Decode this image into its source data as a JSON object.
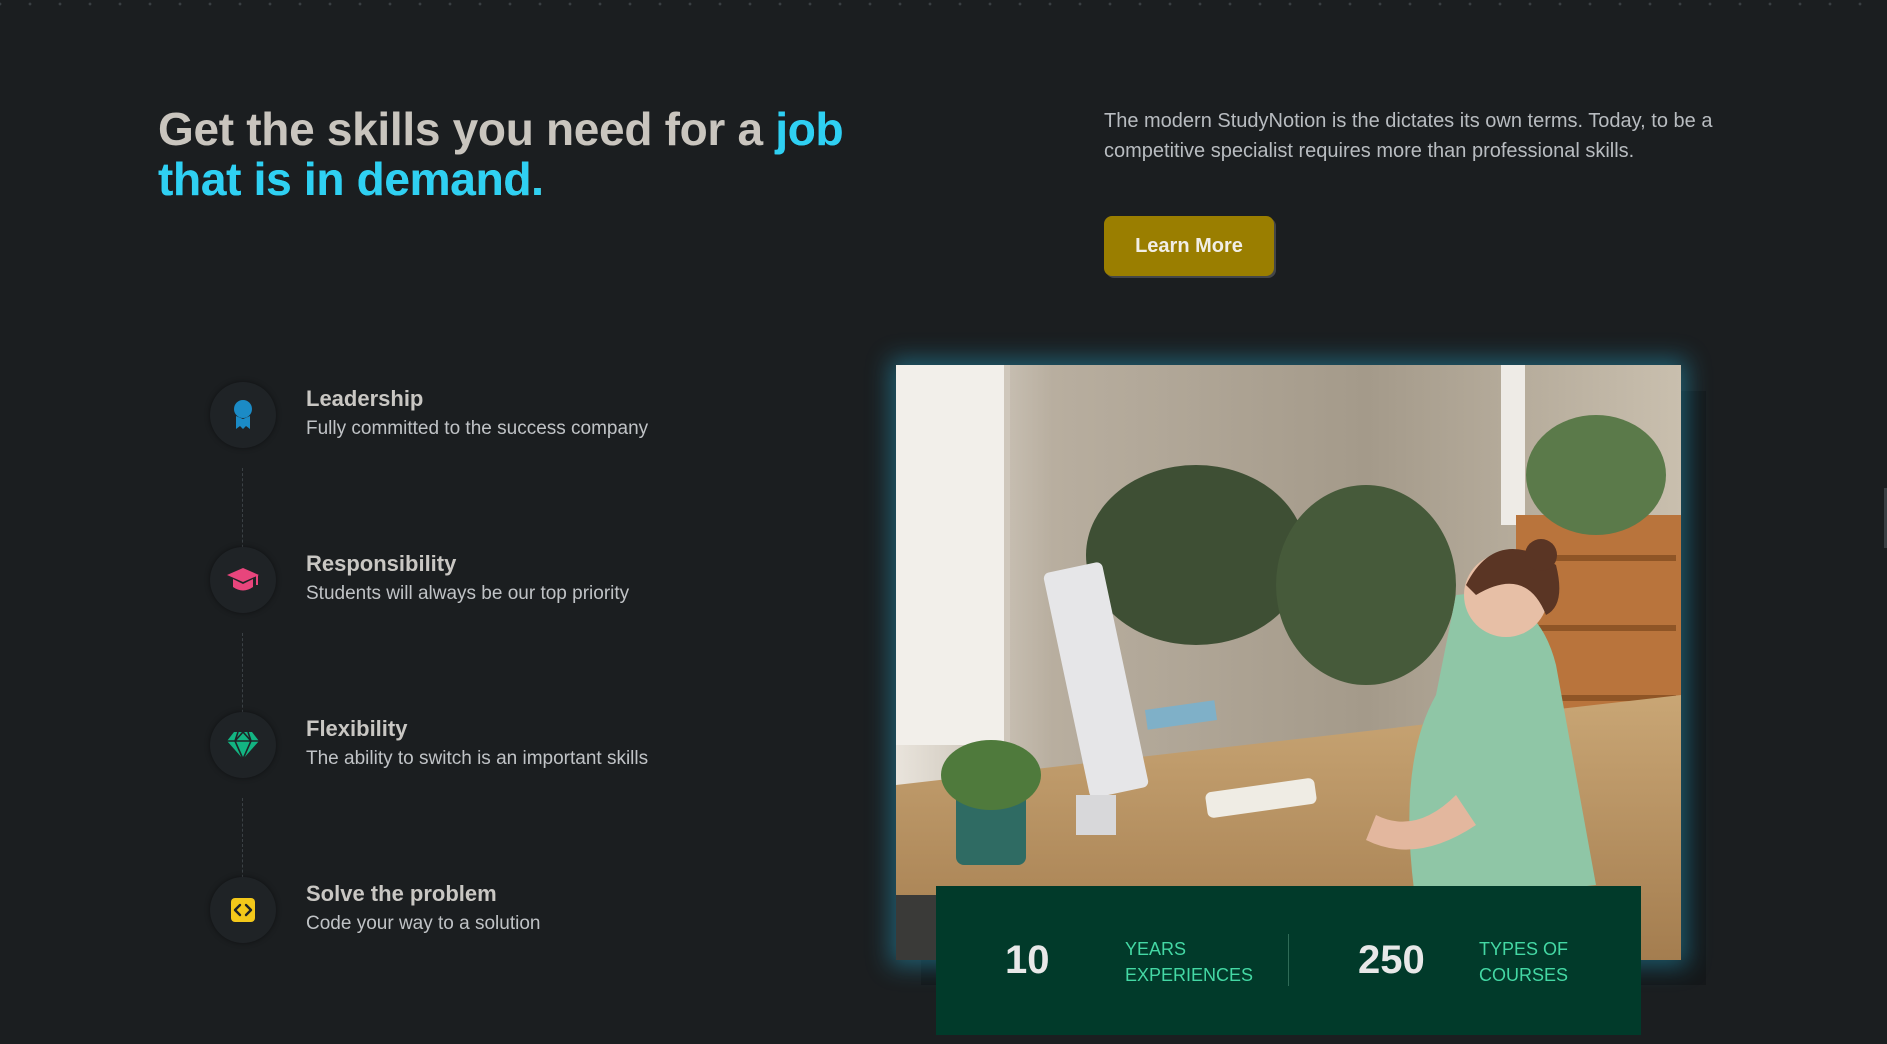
{
  "hero": {
    "headline_plain": "Get the skills you need for a ",
    "headline_accent": "job that is in demand.",
    "intro": "The modern StudyNotion is the dictates its own terms. Today, to be a competitive specialist requires more than professional skills.",
    "button_label": "Learn More"
  },
  "timeline": [
    {
      "icon": "award-badge-icon",
      "icon_color": "#1b8bc6",
      "title": "Leadership",
      "description": "Fully committed to the success company"
    },
    {
      "icon": "graduation-cap-icon",
      "icon_color": "#e8457c",
      "title": "Responsibility",
      "description": "Students will always be our top priority"
    },
    {
      "icon": "diamond-icon",
      "icon_color": "#13b482",
      "title": "Flexibility",
      "description": "The ability to switch is an important skills"
    },
    {
      "icon": "code-icon",
      "icon_color": "#f3c81a",
      "title": "Solve the problem",
      "description": "Code your way to a solution"
    }
  ],
  "stats": [
    {
      "value": "10",
      "label": "Years Experiences"
    },
    {
      "value": "250",
      "label": "Types of Courses"
    }
  ],
  "colors": {
    "background": "#1b1e20",
    "accent_button": "#9a7e00",
    "stats_panel": "#013a2a",
    "stats_label": "#44d8a4",
    "glow": "#26aad0"
  }
}
